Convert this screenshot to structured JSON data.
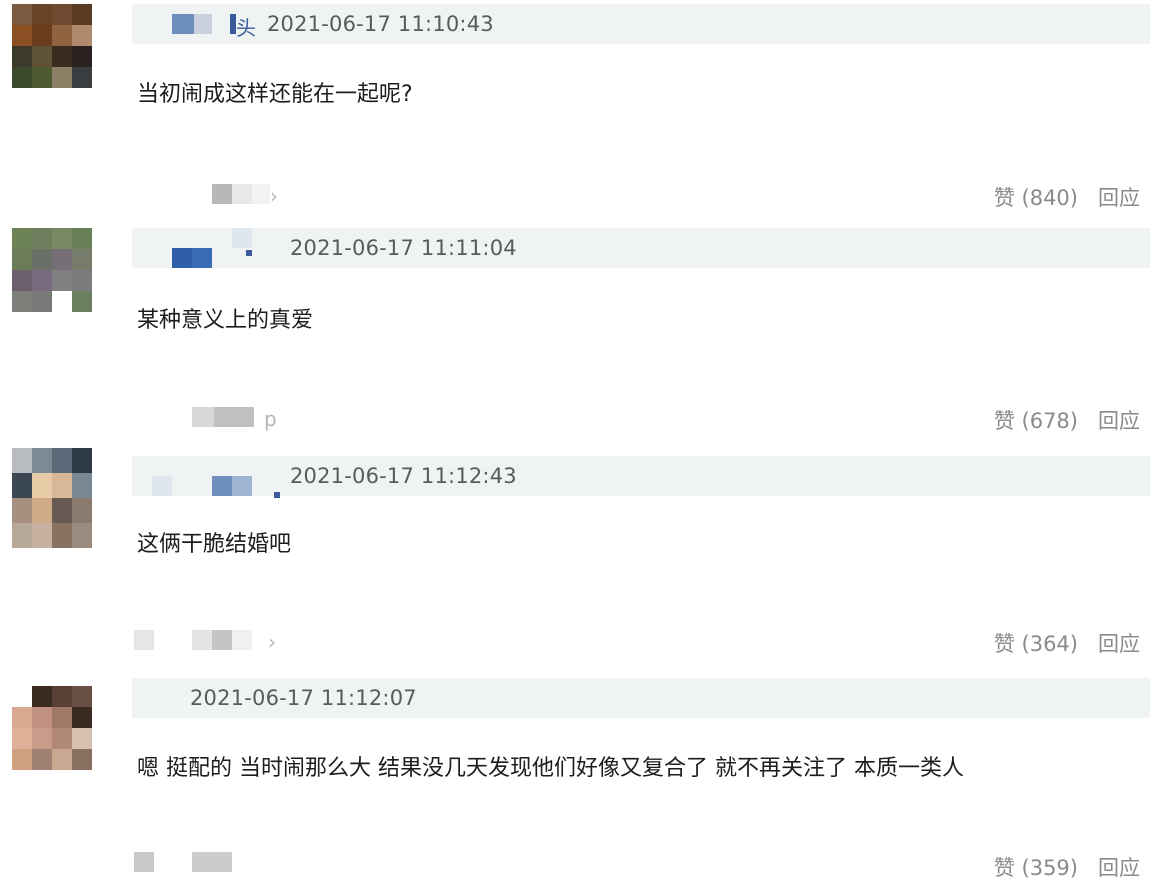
{
  "comments": [
    {
      "timestamp": "2021-06-17 11:10:43",
      "text": "当初闹成这样还能在一起呢?",
      "like_label": "赞 (840)",
      "reply_label": "回应",
      "name_fragment": "头",
      "avatar_colors": [
        "#7b5a3f",
        "#6a4426",
        "#704a30",
        "#5b3a22",
        "#8a5023",
        "#6b3d1d",
        "#8f6240",
        "#b08a6a",
        "#3c3a2a",
        "#5f5236",
        "#3a2a1f",
        "#2a2220",
        "#3b4a2a",
        "#4d5a30",
        "#8a8066",
        "#3a3d40"
      ]
    },
    {
      "timestamp": "2021-06-17 11:11:04",
      "text": "某种意义上的真爱",
      "like_label": "赞 (678)",
      "reply_label": "回应",
      "name_fragment": "",
      "avatar_colors": [
        "#6e8355",
        "#6f7f5e",
        "#788a64",
        "#687e54",
        "#6a7c58",
        "#6a7068",
        "#776f78",
        "#767b6a",
        "#6e5f70",
        "#7a6a80",
        "#808080",
        "#7c7c7e",
        "#7d7f7b",
        "#767976",
        "#ffffff",
        "#6c8060"
      ]
    },
    {
      "timestamp": "2021-06-17 11:12:43",
      "text": "这俩干脆结婚吧",
      "like_label": "赞 (364)",
      "reply_label": "回应",
      "name_fragment": "",
      "avatar_colors": [
        "#b8bcc0",
        "#7c8a96",
        "#5a6a78",
        "#2e3a46",
        "#3b4854",
        "#e8cca8",
        "#d8b898",
        "#7a8894",
        "#a89080",
        "#cfaa88",
        "#665a52",
        "#8a7a70",
        "#b8a898",
        "#c8b0a0",
        "#8a7262",
        "#9a8a80"
      ]
    },
    {
      "timestamp": "2021-06-17 11:12:07",
      "text": "嗯 挺配的 当时闹那么大 结果没几天发现他们好像又复合了 就不再关注了 本质一类人",
      "like_label": "赞 (359)",
      "reply_label": "回应",
      "name_fragment": "",
      "avatar_colors": [
        "#ffffff",
        "#3a2a22",
        "#5a4034",
        "#6a5044",
        "#d8a890",
        "#c09080",
        "#a07868",
        "#3a2a22",
        "#e0b098",
        "#c89c88",
        "#b08878",
        "#d8c0b0",
        "#d0a080",
        "#a08070",
        "#c8a890",
        "#8a7060"
      ]
    }
  ]
}
